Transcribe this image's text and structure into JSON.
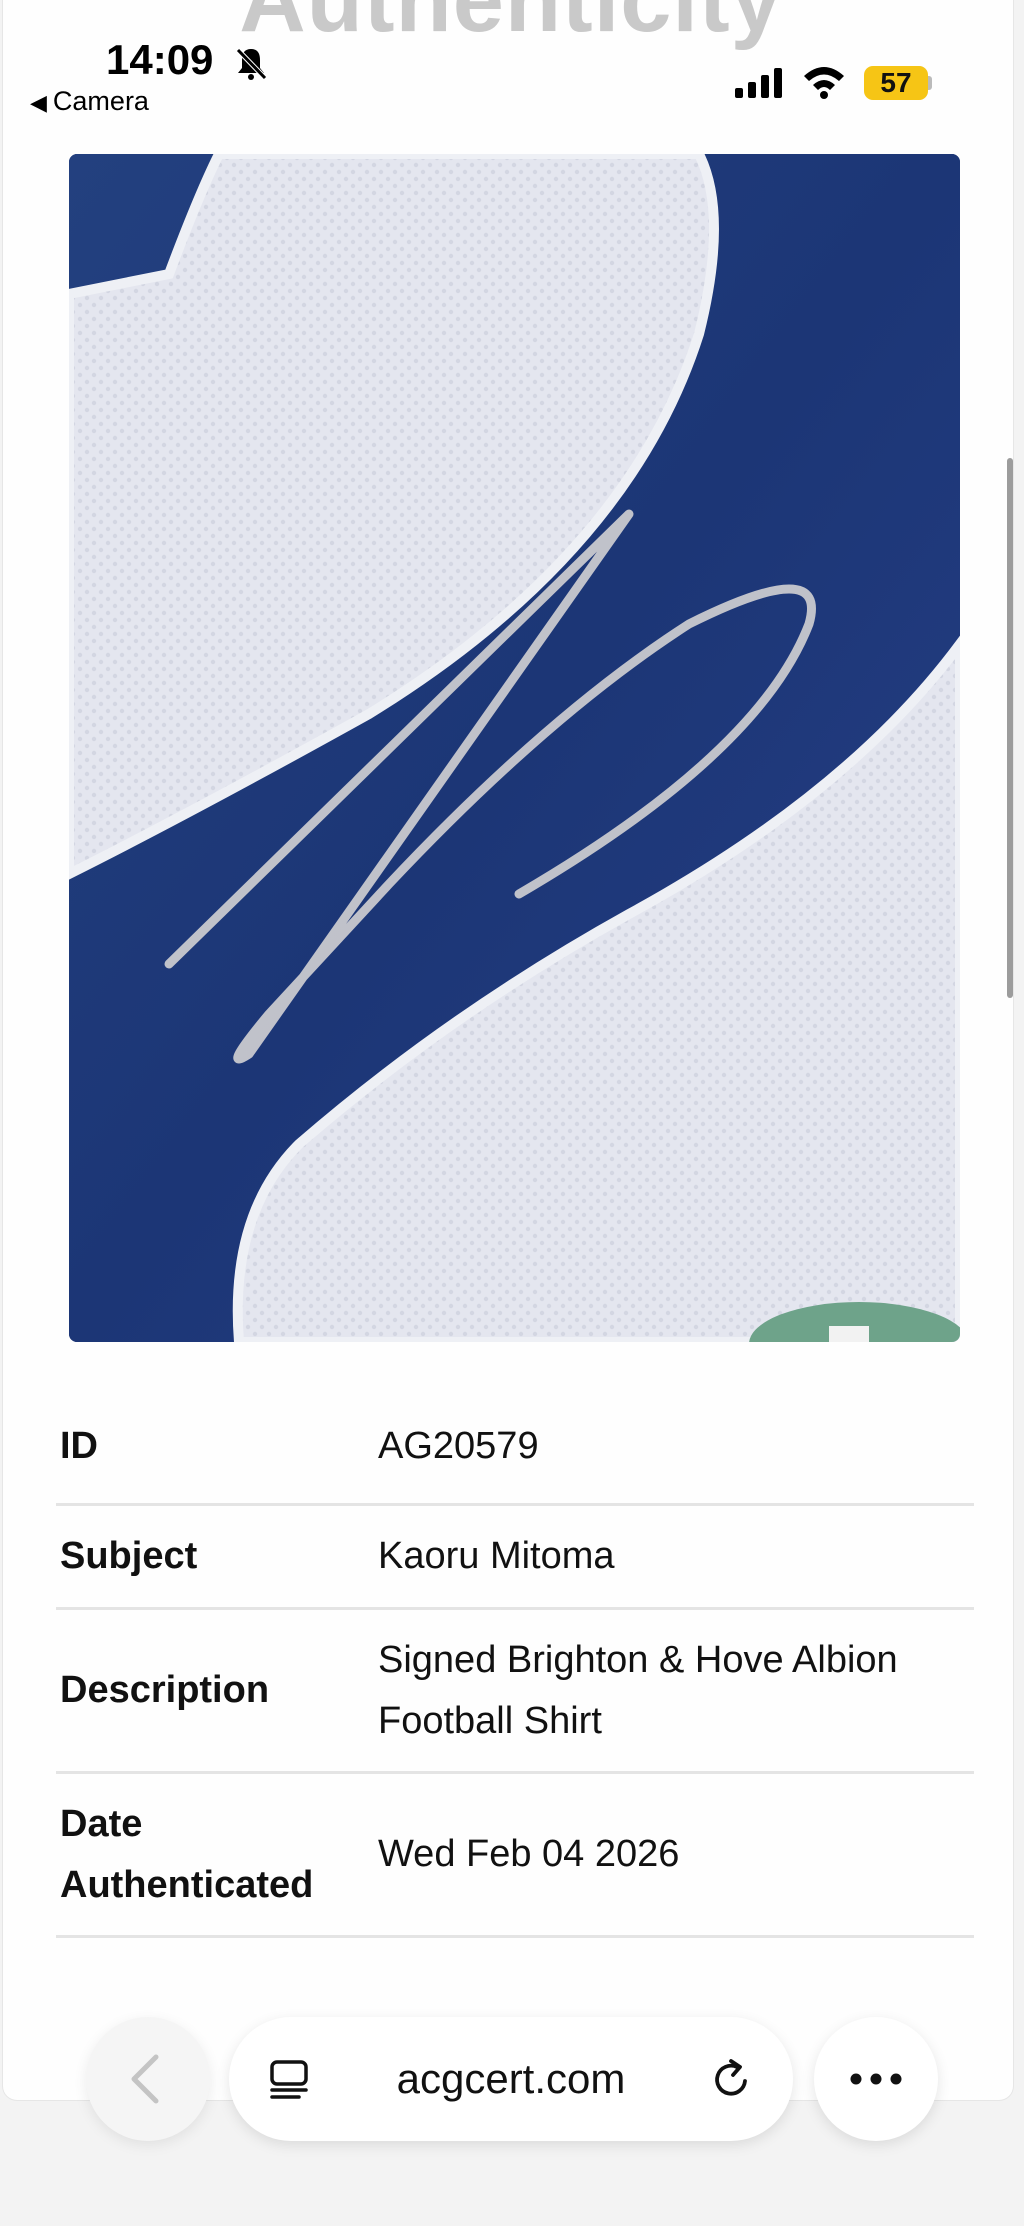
{
  "background_heading": "Authenticity",
  "status_bar": {
    "time": "14:09",
    "back_app": "Camera",
    "battery_level": "57"
  },
  "photo": {
    "icon": "signed-shirt-photo"
  },
  "details": {
    "rows": [
      {
        "key": "ID",
        "value": "AG20579"
      },
      {
        "key": "Subject",
        "value": "Kaoru Mitoma"
      },
      {
        "key": "Description",
        "value": "Signed Brighton & Hove Albion Football Shirt"
      },
      {
        "key": "Date Authenticated",
        "value": "Wed Feb 04 2026"
      }
    ]
  },
  "browser_toolbar": {
    "url": "acgcert.com"
  },
  "colors": {
    "battery": "#f6c515",
    "shirt_navy": "#1e3a7f",
    "shirt_white": "#e6e8f0"
  }
}
